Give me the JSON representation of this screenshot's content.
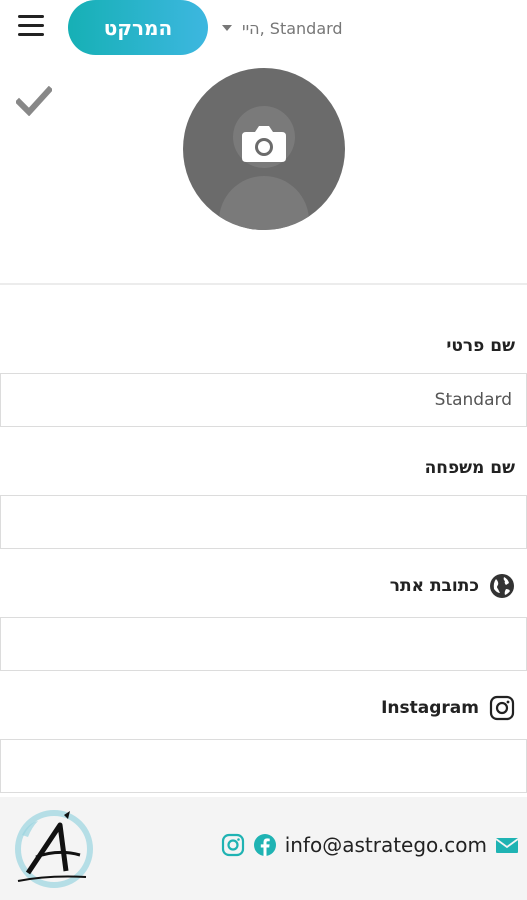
{
  "header": {
    "market_label": "המרקט",
    "user_greeting": "היי, Standard"
  },
  "form": {
    "first_name_label": "שם פרטי",
    "first_name_value": "Standard",
    "last_name_label": "שם משפחה",
    "last_name_value": "",
    "website_label": "כתובת אתר",
    "website_value": "",
    "instagram_label": "Instagram",
    "instagram_value": ""
  },
  "footer": {
    "email": "info@astratego.com"
  },
  "colors": {
    "accent_start": "#16b0b5",
    "accent_end": "#3db7e0",
    "footer_icons": "#1fb3b3"
  }
}
